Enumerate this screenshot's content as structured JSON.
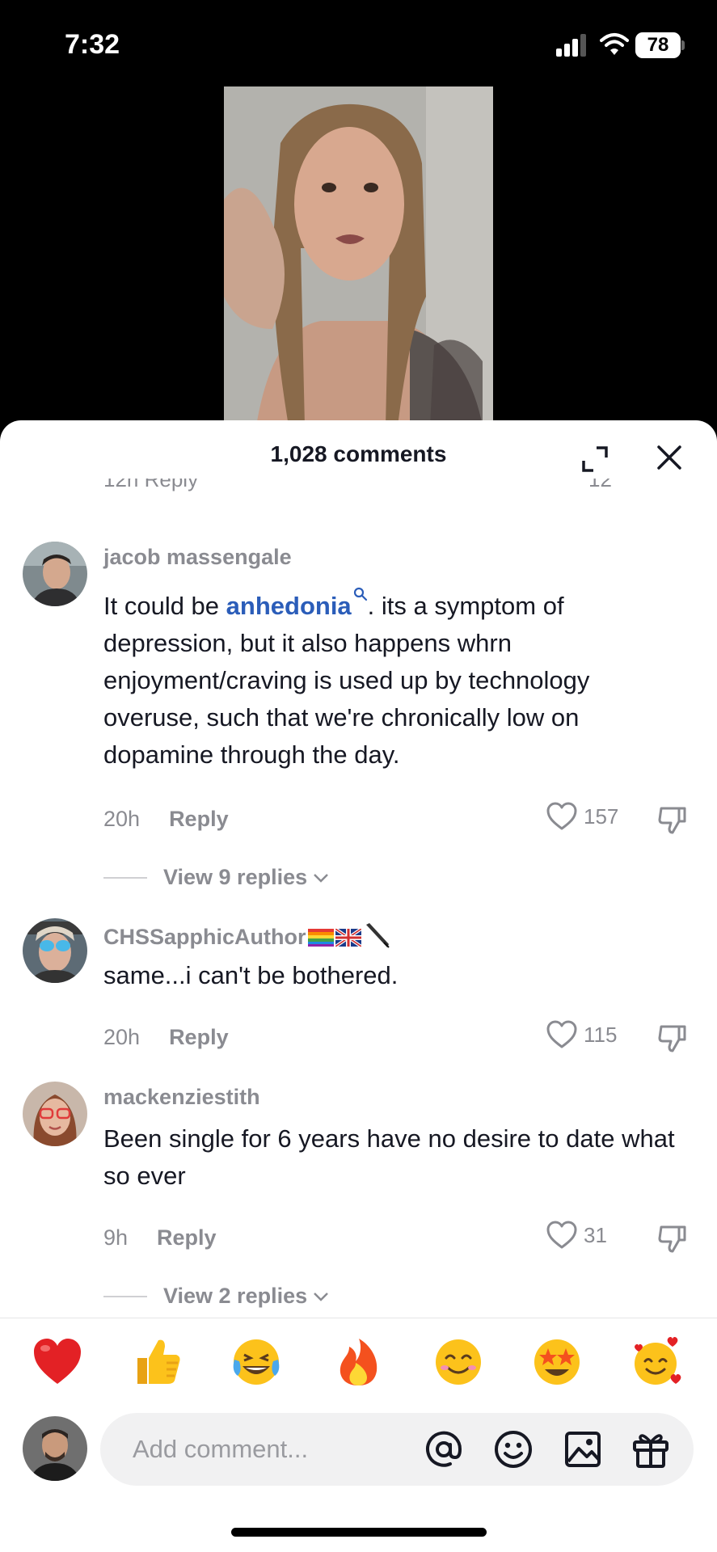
{
  "status": {
    "time": "7:32",
    "battery": "78"
  },
  "sheet": {
    "title": "1,028 comments",
    "cutoff_left": "12h   Reply",
    "cutoff_right": "12"
  },
  "comments": [
    {
      "username": "jacob massengale",
      "text_before": "It could be ",
      "link": "anhedonia",
      "text_after": ". its a symptom of depression, but it also happens whrn enjoyment/craving is used up by technology overuse, such that we're chronically low on dopamine through the day.",
      "time": "20h",
      "reply": "Reply",
      "likes": "157",
      "view_replies": "View 9 replies"
    },
    {
      "username": "CHSSapphicAuthor",
      "text": "same...i can't be bothered.",
      "time": "20h",
      "reply": "Reply",
      "likes": "115"
    },
    {
      "username": "mackenziestith",
      "text": "Been single for 6 years have no desire to date what so ever",
      "time": "9h",
      "reply": "Reply",
      "likes": "31",
      "view_replies": "View 2 replies"
    }
  ],
  "emojis": [
    "❤️",
    "👍",
    "😂",
    "🔥",
    "😊",
    "🤩",
    "🥰"
  ],
  "composer": {
    "placeholder": "Add comment..."
  },
  "icons": [
    "signal-icon",
    "wifi-icon",
    "expand-icon",
    "close-icon",
    "heart-icon",
    "dislike-icon",
    "chevron-down-icon",
    "mention-icon",
    "emoji-icon",
    "image-icon",
    "gift-icon"
  ]
}
